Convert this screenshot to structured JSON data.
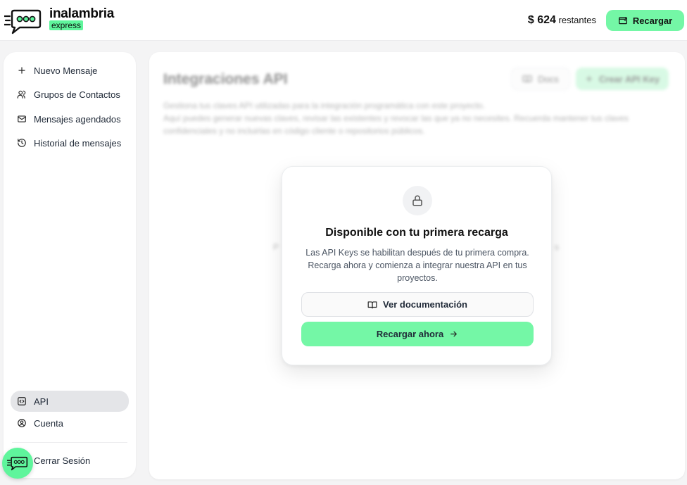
{
  "brand": {
    "name": "inalambria",
    "sub": "express"
  },
  "header": {
    "balance_amount": "$ 624",
    "balance_suffix": "restantes",
    "recharge_label": "Recargar"
  },
  "sidebar": {
    "items": [
      {
        "label": "Nuevo Mensaje",
        "icon": "plus-icon"
      },
      {
        "label": "Grupos de Contactos",
        "icon": "users-icon"
      },
      {
        "label": "Mensajes agendados",
        "icon": "mail-icon"
      },
      {
        "label": "Historial de mensajes",
        "icon": "history-icon"
      }
    ],
    "bottom_items": [
      {
        "label": "API",
        "icon": "code-icon",
        "active": true
      },
      {
        "label": "Cuenta",
        "icon": "user-circle-icon"
      }
    ],
    "logout_label": "Cerrar Sesión"
  },
  "main": {
    "title": "Integraciones API",
    "docs_label": "Docs",
    "create_label": "Crear API Key",
    "description_1": "Gestiona tus claves API utilizadas para la integración programática con este proyecto.",
    "description_2": "Aquí puedes generar nuevas claves, revisar las existentes y revocar las que ya no necesites. Recuerda mantener tus claves confidenciales y no incluirlas en código cliente o repositorios públicos.",
    "ghost_left": "P",
    "ghost_right": "s"
  },
  "card": {
    "icon": "lock-icon",
    "title": "Disponible con tu primera recarga",
    "body": "Las API Keys se habilitan después de tu primera compra. Recarga ahora y comienza a integrar nuestra API en tus proyectos.",
    "doc_button": "Ver documentación",
    "recharge_button": "Recargar ahora"
  },
  "colors": {
    "accent": "#74f7a6",
    "accent_strong": "#5ff59c",
    "active_nav": "#e4e5e8"
  }
}
